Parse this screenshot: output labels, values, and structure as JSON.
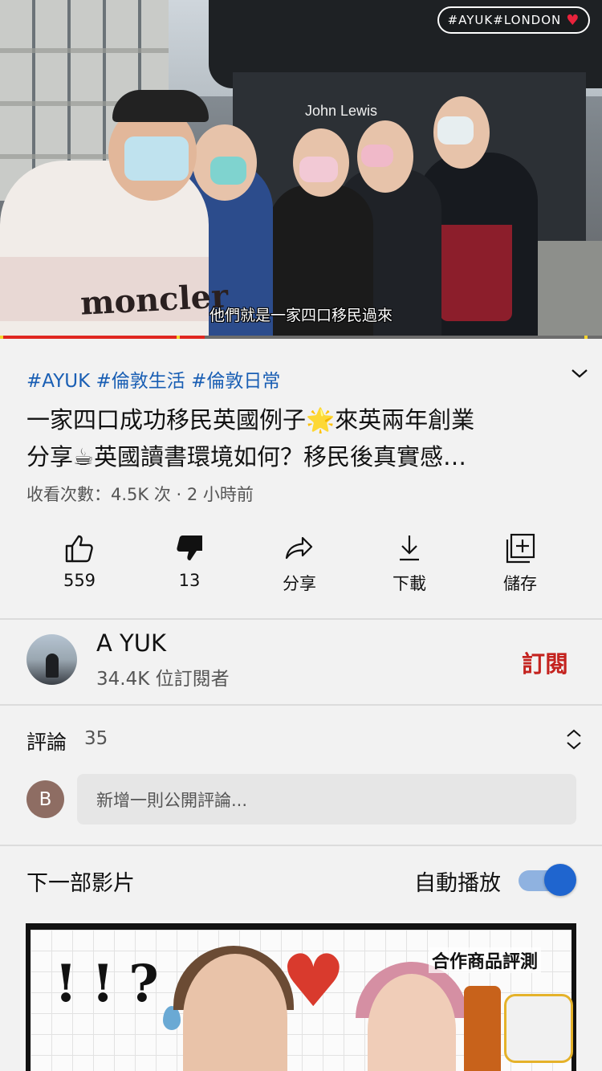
{
  "player": {
    "overlay_tag": "#AYUK#LONDON",
    "store_sign": "John Lewis",
    "shirt_text": "moncler",
    "subtitle": "他們就是一家四口移民過來",
    "progress_fraction": 0.34
  },
  "video": {
    "tags": "#AYUK #倫敦生活 #倫敦日常",
    "title_line1": "一家四口成功移民英國例子🌟來英兩年創業",
    "title_line2": "分享☕英國讀書環境如何？移民後真實感…",
    "meta": "收看次數：4.5K 次 · 2 小時前"
  },
  "actions": {
    "like": "559",
    "dislike": "13",
    "share": "分享",
    "download": "下載",
    "save": "儲存"
  },
  "channel": {
    "name": "A YUK",
    "subscribers": "34.4K 位訂閱者",
    "subscribe_label": "訂閱"
  },
  "comments": {
    "label": "評論",
    "count": "35",
    "user_initial": "B",
    "placeholder": "新增一則公開評論..."
  },
  "up_next": {
    "label": "下一部影片",
    "autoplay_label": "自動播放",
    "autoplay_on": true,
    "thumbnail_marks": "!!?",
    "thumbnail_caption": "合作商品評測"
  },
  "colors": {
    "link_blue": "#1a5fb4",
    "subscribe_red": "#c4231f",
    "progress_red": "#e0261f",
    "toggle_blue": "#1f65cf"
  }
}
